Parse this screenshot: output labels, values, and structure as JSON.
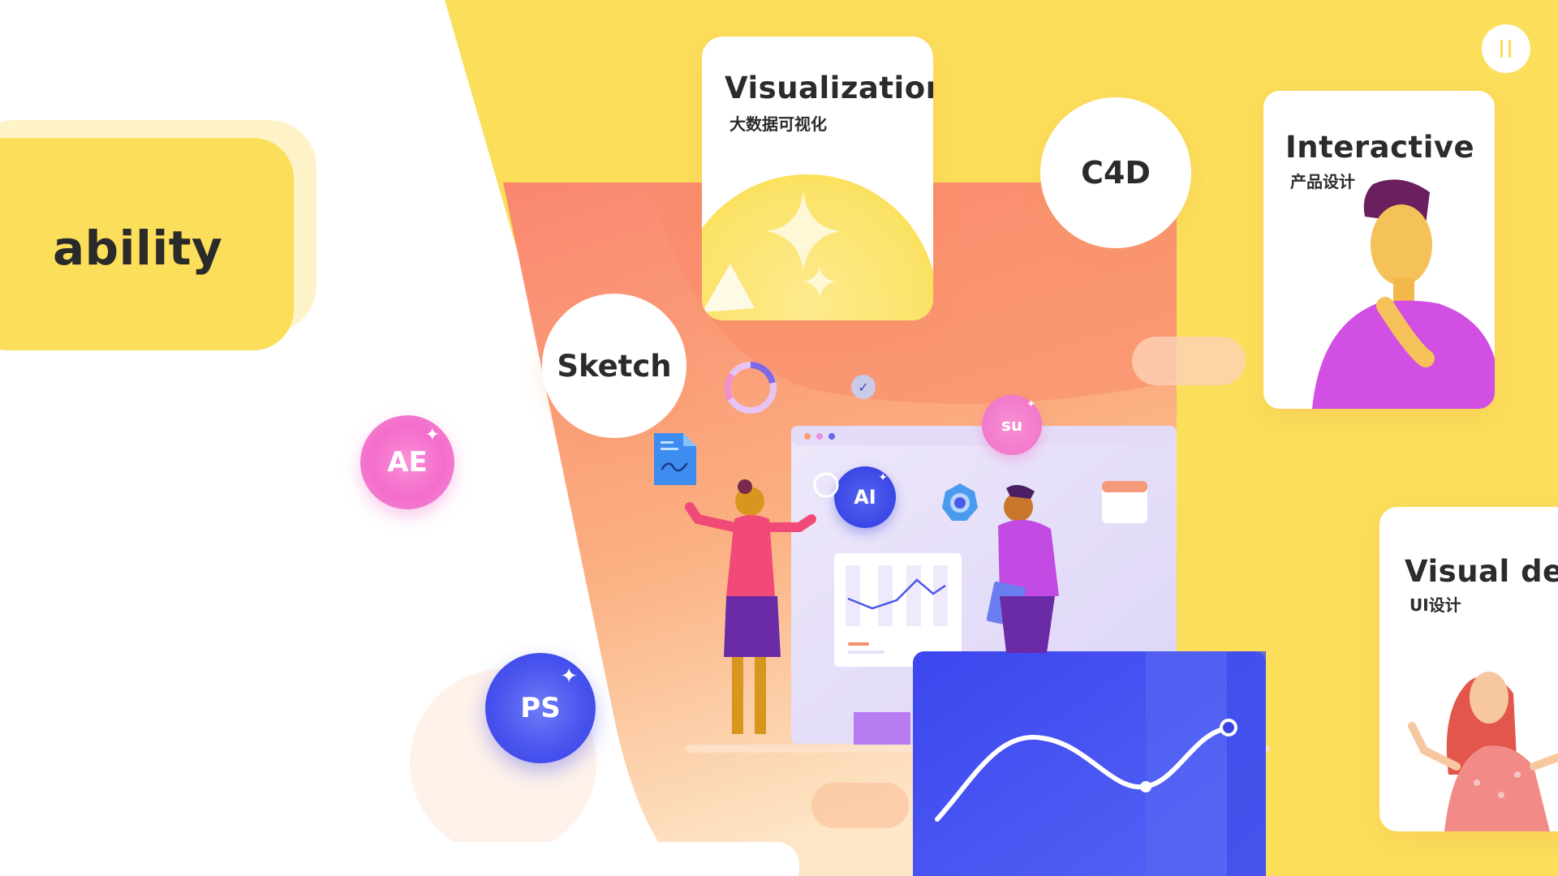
{
  "hero": {
    "label": "ability"
  },
  "cards": {
    "visualization": {
      "title": "Visualization",
      "subtitle": "大数据可视化"
    },
    "interactive": {
      "title": "Interactive",
      "subtitle": "产品设计"
    },
    "visual_design": {
      "title": "Visual des",
      "subtitle": "UI设计"
    }
  },
  "tools": {
    "c4d": "C4D",
    "sketch": "Sketch",
    "ae": "AE",
    "ps": "PS",
    "ai": "AI",
    "su": "su"
  },
  "colors": {
    "yellow": "#FBDE5A",
    "orange": "#FA8E6E",
    "blue": "#4455F0",
    "pink": "#F060C8",
    "purple": "#B05AE8"
  },
  "icons": {
    "pause": "pause-icon",
    "sparkle": "sparkle-icon",
    "file": "file-chart-icon",
    "check": "check-icon",
    "gear": "gear-icon",
    "calendar": "calendar-icon",
    "search": "search-icon"
  }
}
